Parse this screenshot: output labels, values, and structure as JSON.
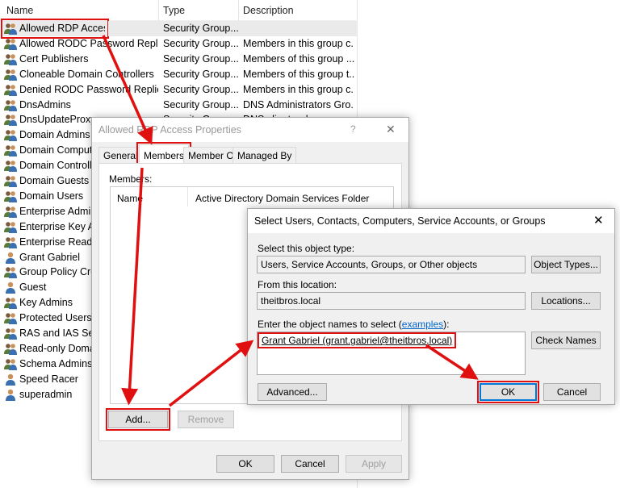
{
  "list": {
    "headers": {
      "name": "Name",
      "type": "Type",
      "description": "Description"
    },
    "rows": [
      {
        "name": "Allowed RDP Access",
        "type": "Security Group...",
        "description": "",
        "kind": "group"
      },
      {
        "name": "Allowed RODC Password Repli...",
        "type": "Security Group...",
        "description": "Members in this group c...",
        "kind": "group"
      },
      {
        "name": "Cert Publishers",
        "type": "Security Group...",
        "description": "Members of this group ...",
        "kind": "group"
      },
      {
        "name": "Cloneable Domain Controllers",
        "type": "Security Group...",
        "description": "Members of this group t...",
        "kind": "group"
      },
      {
        "name": "Denied RODC Password Replic...",
        "type": "Security Group...",
        "description": "Members in this group c...",
        "kind": "group"
      },
      {
        "name": "DnsAdmins",
        "type": "Security Group...",
        "description": "DNS Administrators Gro...",
        "kind": "group"
      },
      {
        "name": "DnsUpdateProxy",
        "type": "Security Group...",
        "description": "DNS clients who...",
        "kind": "group"
      },
      {
        "name": "Domain Admins",
        "type": "",
        "description": "",
        "kind": "group"
      },
      {
        "name": "Domain Computers",
        "type": "",
        "description": "",
        "kind": "group"
      },
      {
        "name": "Domain Controllers",
        "type": "",
        "description": "",
        "kind": "group"
      },
      {
        "name": "Domain Guests",
        "type": "",
        "description": "",
        "kind": "group"
      },
      {
        "name": "Domain Users",
        "type": "",
        "description": "",
        "kind": "group"
      },
      {
        "name": "Enterprise Admins",
        "type": "",
        "description": "",
        "kind": "group"
      },
      {
        "name": "Enterprise Key Admins",
        "type": "",
        "description": "",
        "kind": "group"
      },
      {
        "name": "Enterprise Read-only",
        "type": "",
        "description": "",
        "kind": "group"
      },
      {
        "name": "Grant Gabriel",
        "type": "",
        "description": "",
        "kind": "user"
      },
      {
        "name": "Group Policy Creator",
        "type": "",
        "description": "",
        "kind": "group"
      },
      {
        "name": "Guest",
        "type": "",
        "description": "",
        "kind": "user"
      },
      {
        "name": "Key Admins",
        "type": "",
        "description": "",
        "kind": "group"
      },
      {
        "name": "Protected Users",
        "type": "",
        "description": "",
        "kind": "group"
      },
      {
        "name": "RAS and IAS Servers",
        "type": "",
        "description": "",
        "kind": "group"
      },
      {
        "name": "Read-only Domain",
        "type": "",
        "description": "",
        "kind": "group"
      },
      {
        "name": "Schema Admins",
        "type": "",
        "description": "",
        "kind": "group"
      },
      {
        "name": "Speed Racer",
        "type": "",
        "description": "",
        "kind": "user"
      },
      {
        "name": "superadmin",
        "type": "",
        "description": "",
        "kind": "user"
      }
    ]
  },
  "props": {
    "title": "Allowed RDP Access Properties",
    "help": "?",
    "close": "✕",
    "tabs": [
      "General",
      "Members",
      "Member Of",
      "Managed By"
    ],
    "members_label": "Members:",
    "col_name": "Name",
    "col_folder": "Active Directory Domain Services Folder",
    "add": "Add...",
    "remove": "Remove",
    "ok": "OK",
    "cancel": "Cancel",
    "apply": "Apply"
  },
  "select": {
    "title": "Select Users, Contacts, Computers, Service Accounts, or Groups",
    "close": "✕",
    "type_label": "Select this object type:",
    "type_value": "Users, Service Accounts, Groups, or Other objects",
    "object_types": "Object Types...",
    "loc_label": "From this location:",
    "loc_value": "theitbros.local",
    "locations": "Locations...",
    "names_label": "Enter the object names to select (",
    "examples": "examples",
    "names_label_end": "):",
    "names_value": "Grant Gabriel (grant.gabriel@theitbros.local)",
    "check_names": "Check Names",
    "advanced": "Advanced...",
    "ok": "OK",
    "cancel": "Cancel"
  },
  "colors": {
    "highlight": "#e01010",
    "link": "#0066cc"
  }
}
